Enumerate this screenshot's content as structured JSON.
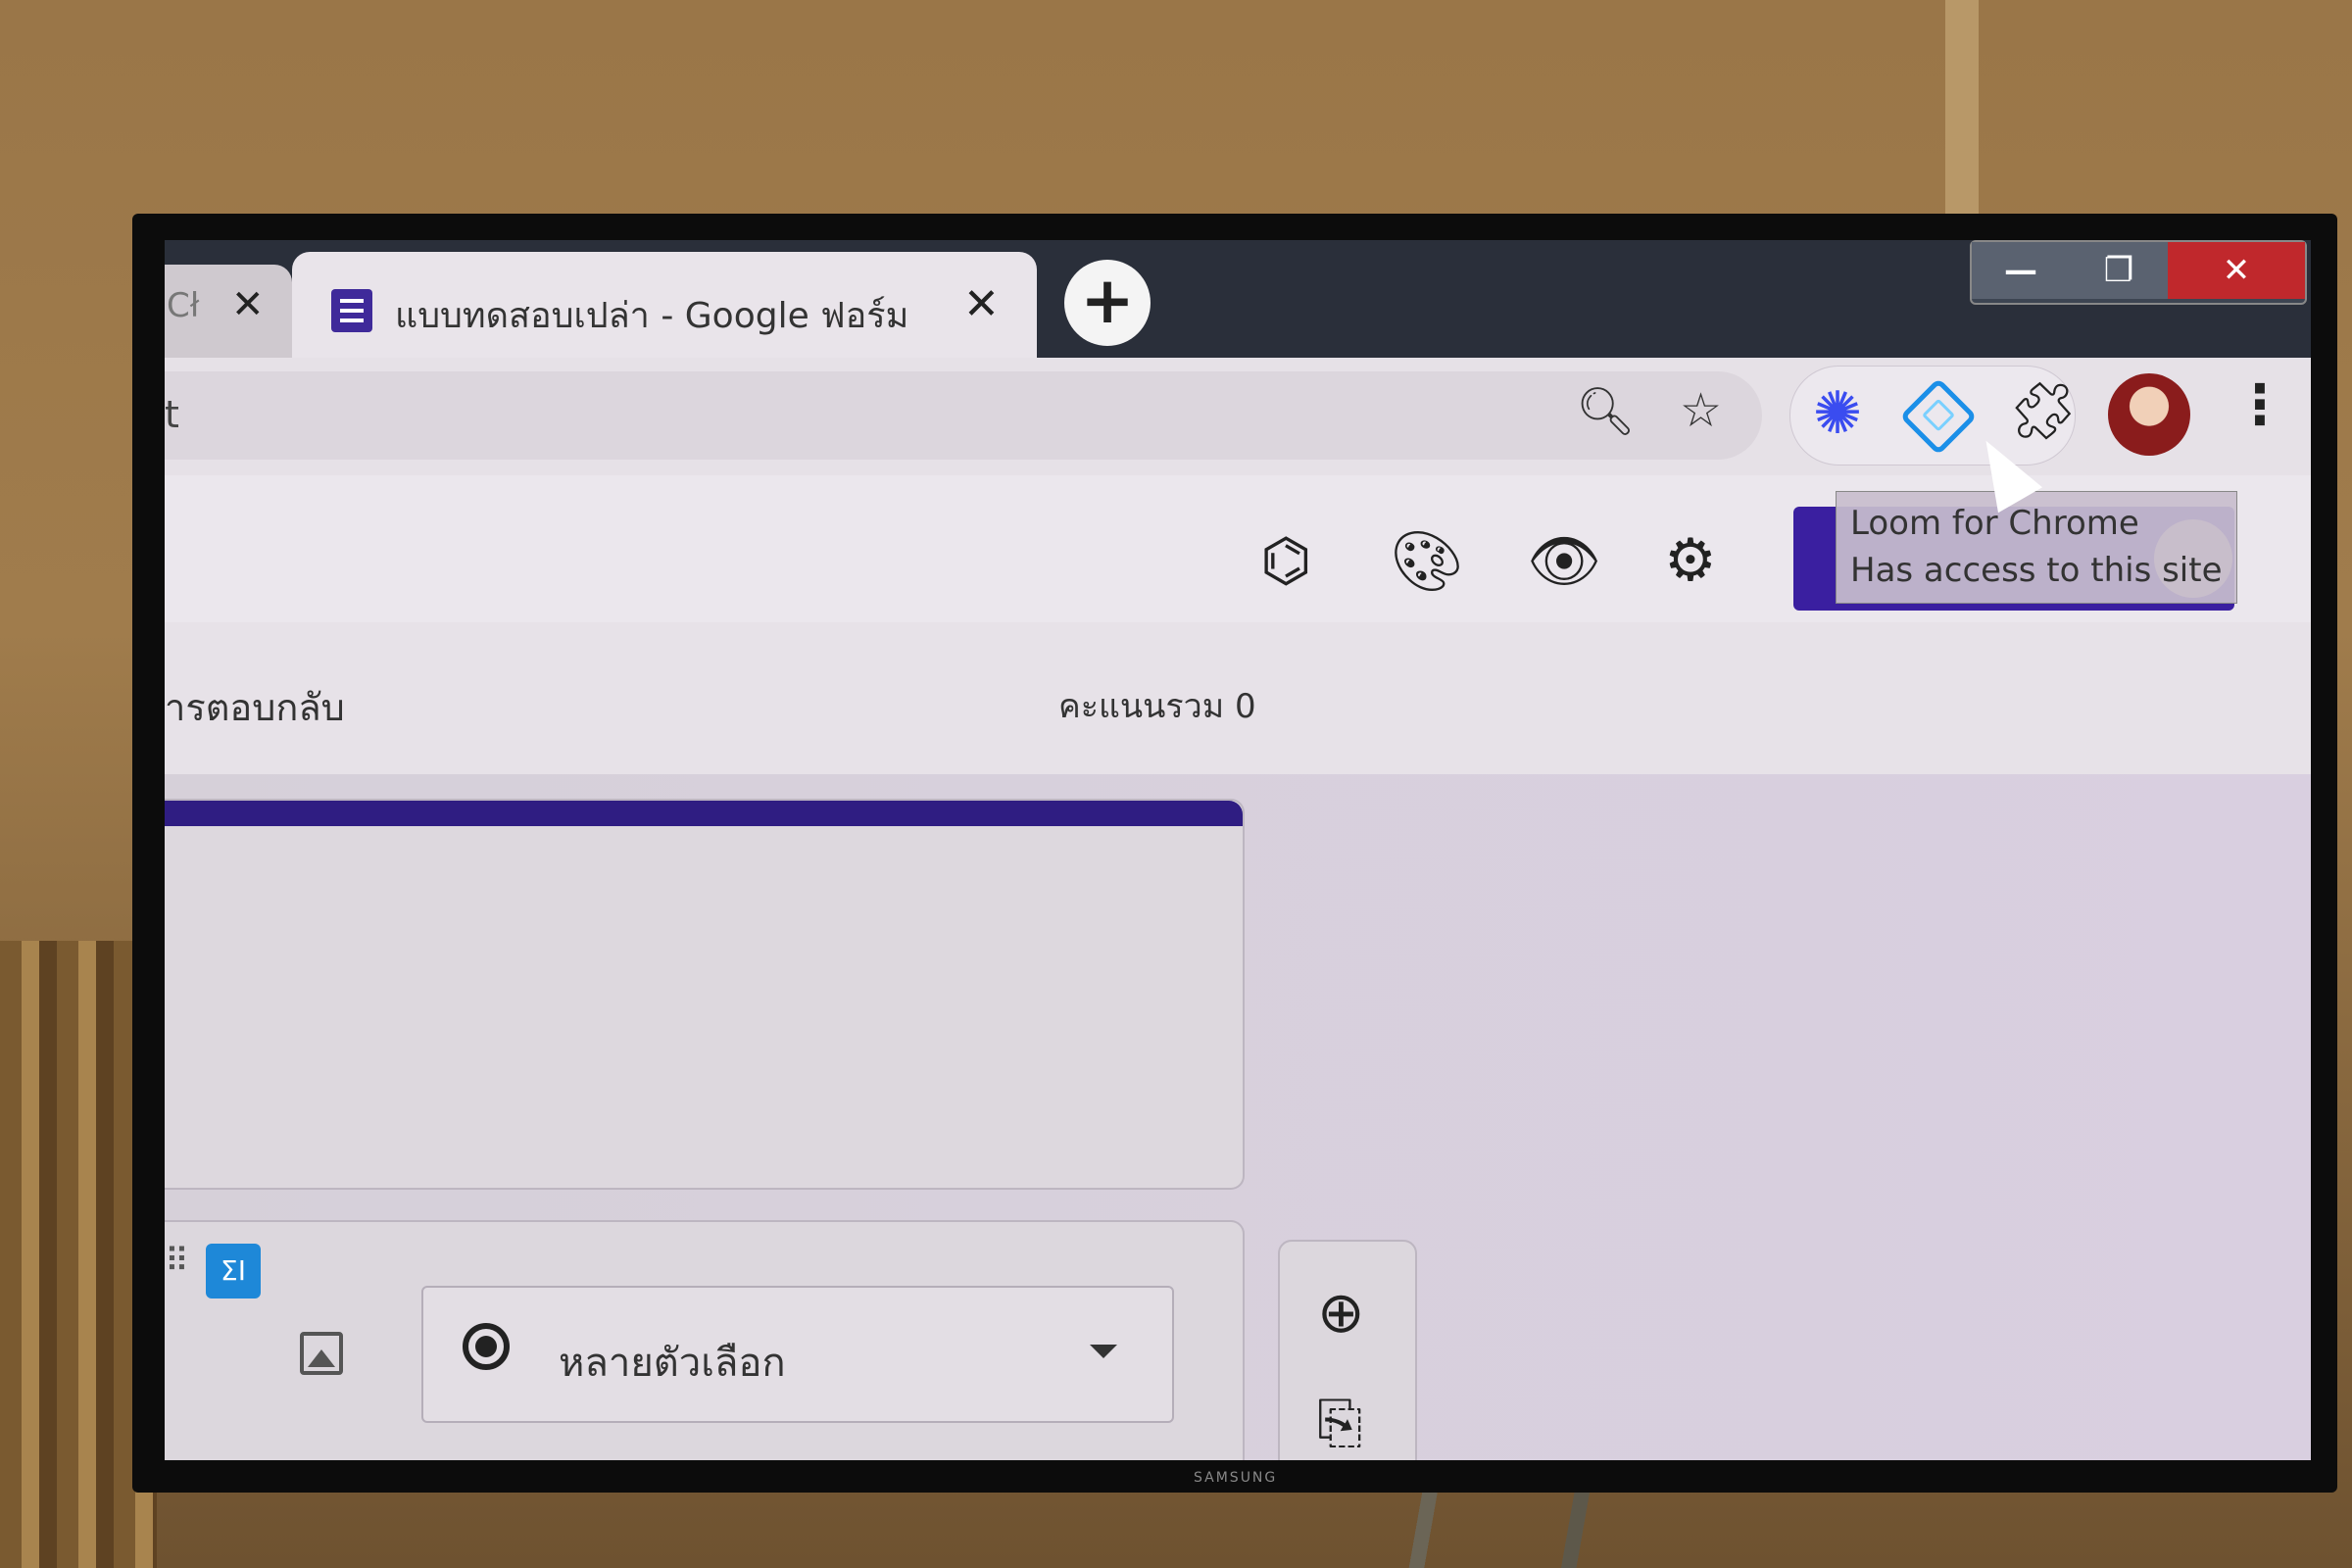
{
  "browser": {
    "tabs": [
      {
        "label": "Cł",
        "close": "✕"
      },
      {
        "label": "แบบทดสอบเปล่า - Google ฟอร์ม",
        "close": "✕",
        "active": true
      }
    ],
    "new_tab": "+",
    "window_controls": {
      "minimize": "—",
      "maximize": "❐",
      "close": "✕"
    },
    "omnibox_fragment": "t",
    "toolbar_icons": [
      "zoom-out-icon",
      "bookmark-star-icon",
      "loom-extension-icon",
      "diamond-extension-icon",
      "extensions-puzzle-icon",
      "profile-avatar",
      "menu-kebab-icon"
    ],
    "tooltip": {
      "line1": "Loom for Chrome",
      "line2": "Has access to this site"
    }
  },
  "forms": {
    "header_icons": [
      "addons-puzzle-icon",
      "palette-icon",
      "preview-eye-icon",
      "settings-gear-icon"
    ],
    "tabs": {
      "responses": "ารตอบกลับ",
      "total_points": "คะแนนรวม 0"
    },
    "question": {
      "type_label": "หลายตัวเลือก",
      "sigma_label": "ΣI"
    },
    "side_tools": [
      "add-question-icon",
      "import-questions-icon"
    ]
  },
  "device": {
    "brand": "SAMSUNG"
  },
  "colors": {
    "forms_purple": "#3a1fa0",
    "close_red": "#c0282c",
    "loom_blue": "#3a4cf0",
    "diamond_blue": "#1b8fe8"
  }
}
